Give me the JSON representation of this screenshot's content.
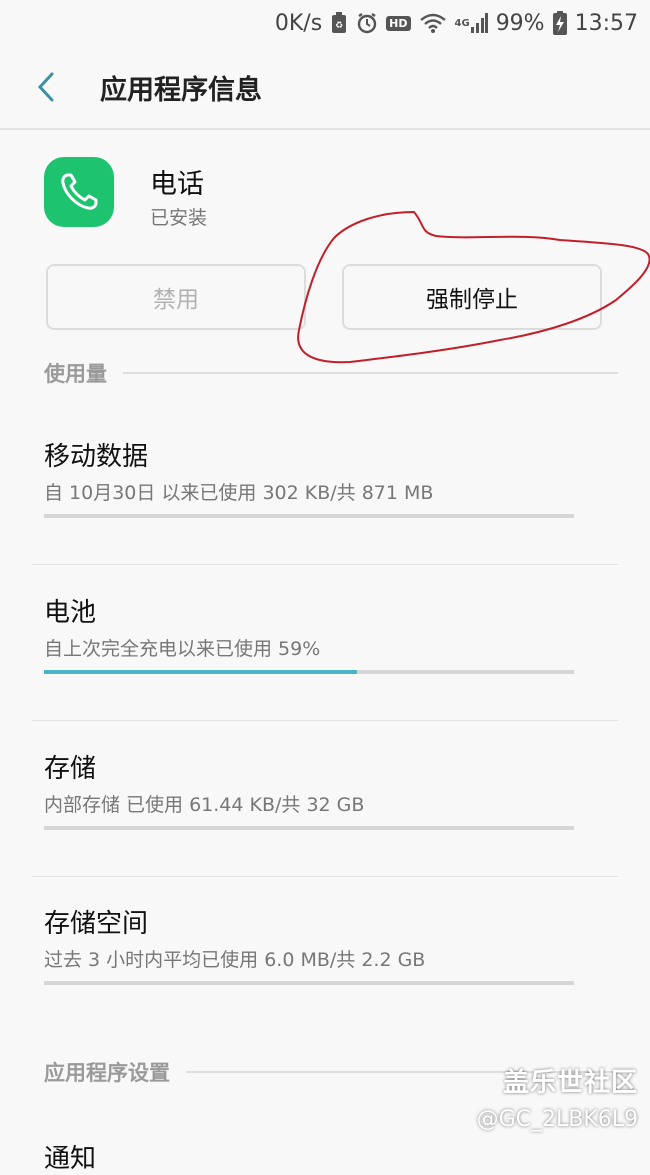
{
  "status_bar": {
    "net_speed": "0K/s",
    "hd_label": "HD",
    "network_label": "4G",
    "battery": "99%",
    "time": "13:57"
  },
  "header": {
    "title": "应用程序信息"
  },
  "app": {
    "name": "电话",
    "status": "已安装",
    "icon_color": "#1ec36f"
  },
  "buttons": {
    "disable_label": "禁用",
    "force_stop_label": "强制停止"
  },
  "usage_section": {
    "title": "使用量",
    "items": [
      {
        "title": "移动数据",
        "subtitle": "自 10月30日 以来已使用 302 KB/共 871 MB",
        "progress": 0.0
      },
      {
        "title": "电池",
        "subtitle": "自上次完全充电以来已使用 59%",
        "progress": 0.59
      },
      {
        "title": "存储",
        "subtitle": "内部存储 已使用 61.44 KB/共 32 GB",
        "progress": 0.0
      },
      {
        "title": "存储空间",
        "subtitle": "过去 3 小时内平均已使用 6.0 MB/共 2.2 GB",
        "progress": 0.0
      }
    ]
  },
  "settings_section": {
    "title": "应用程序设置",
    "first_item": "通知"
  },
  "watermark": {
    "line1": "盖乐世社区",
    "line2": "@GC_2LBK6L9"
  },
  "colors": {
    "accent": "#4db3c8",
    "annotation": "#c0202a"
  }
}
